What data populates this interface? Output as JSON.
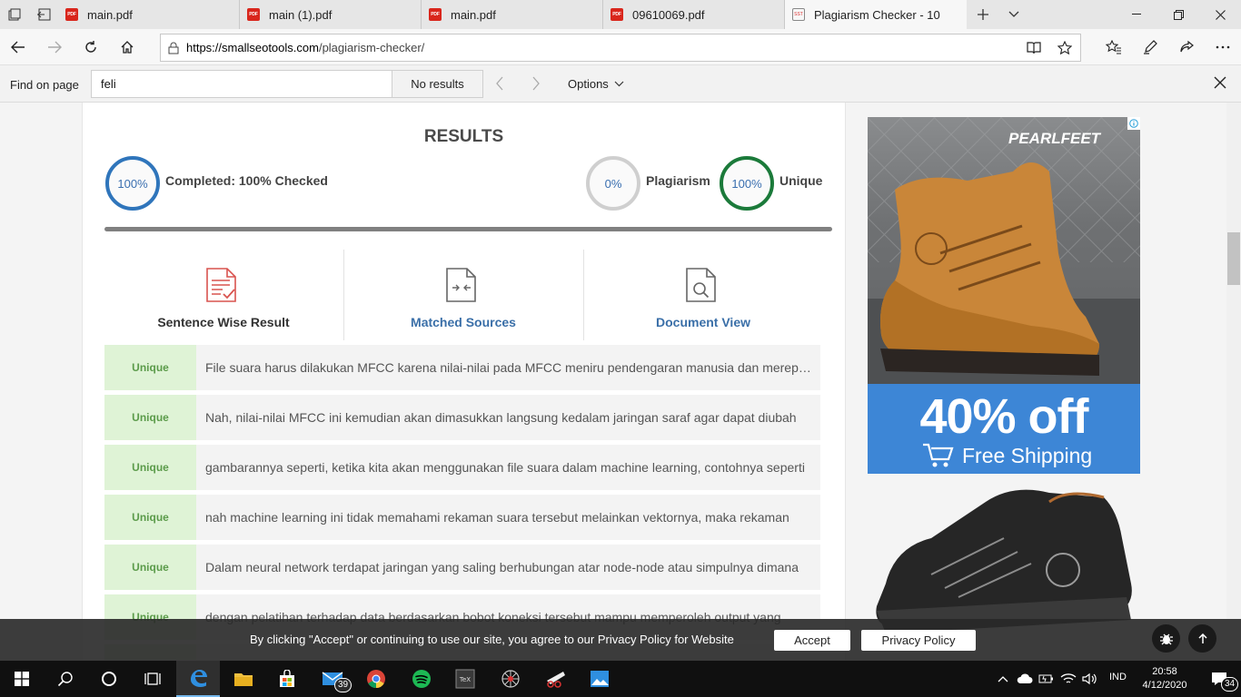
{
  "browser": {
    "tabs": [
      {
        "title": "main.pdf",
        "favicon": "pdf-icon",
        "active": false
      },
      {
        "title": "main (1).pdf",
        "favicon": "pdf-icon",
        "active": false
      },
      {
        "title": "main.pdf",
        "favicon": "pdf-icon",
        "active": false
      },
      {
        "title": "09610069.pdf",
        "favicon": "pdf-icon",
        "active": false
      },
      {
        "title": "Plagiarism Checker - 10",
        "favicon": "sst-icon",
        "active": true
      }
    ],
    "favicon_pdf_text": "PDF",
    "favicon_sst_text": "SST",
    "url_base": "https://smallseotools.com",
    "url_path": "/plagiarism-checker/"
  },
  "find_bar": {
    "label": "Find on page",
    "query": "feli",
    "status": "No results",
    "options_label": "Options"
  },
  "results": {
    "title": "RESULTS",
    "completed_value": "100%",
    "completed_label": "Completed: 100% Checked",
    "plagiarism_value": "0%",
    "plagiarism_label": "Plagiarism",
    "unique_value": "100%",
    "unique_label": "Unique",
    "progress_fraction": 1.0,
    "tabs": [
      {
        "label": "Sentence Wise Result"
      },
      {
        "label": "Matched Sources"
      },
      {
        "label": "Document View"
      }
    ],
    "rows": [
      {
        "status": "Unique",
        "text": "File suara harus dilakukan MFCC karena nilai-nilai pada MFCC meniru pendengaran manusia dan merepresentasikan"
      },
      {
        "status": "Unique",
        "text": "Nah, nilai-nilai MFCC ini kemudian akan dimasukkan langsung kedalam jaringan saraf agar dapat diubah"
      },
      {
        "status": "Unique",
        "text": "gambarannya seperti, ketika kita akan menggunakan file suara dalam machine learning, contohnya seperti"
      },
      {
        "status": "Unique",
        "text": "nah machine learning ini tidak memahami rekaman suara tersebut melainkan vektornya, maka rekaman"
      },
      {
        "status": "Unique",
        "text": "Dalam neural network terdapat jaringan yang saling berhubungan atar node-node atau simpulnya dimana"
      },
      {
        "status": "Unique",
        "text": "dengan pelatihan terhadap data berdasarkan bobot koneksi tersebut mampu memperoleh output yang"
      }
    ],
    "colors": {
      "completed_ring": "#2f75bb",
      "plagiarism_ring": "#cfcfcf",
      "unique_ring": "#1b7a3a",
      "unique_badge_bg": "#dff3d6"
    }
  },
  "ad": {
    "brand": "PEARLFEET",
    "discount": "40% off",
    "shipping": "Free Shipping"
  },
  "cookie_bar": {
    "text": "By clicking \"Accept\" or continuing to use our site, you agree to our Privacy Policy for Website",
    "accept_label": "Accept",
    "privacy_label": "Privacy Policy"
  },
  "taskbar": {
    "mail_badge": "39",
    "language": "IND",
    "time": "20:58",
    "date": "4/12/2020",
    "notification_count": "34"
  }
}
